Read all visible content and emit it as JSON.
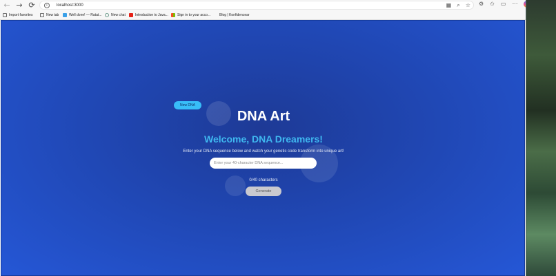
{
  "browser": {
    "url": "localhost:3000",
    "bookmarks": [
      {
        "label": "Import favorites"
      },
      {
        "label": "New tab"
      },
      {
        "label": "Well done! — Ratat..."
      },
      {
        "label": "New chat"
      },
      {
        "label": "Introduction to Java..."
      },
      {
        "label": "Sign in to your acco..."
      },
      {
        "label": "Blog | Konfidencear"
      }
    ]
  },
  "app": {
    "new_dna_label": "New DNA",
    "title": "DNA Art",
    "welcome": "Welcome, DNA Dreamers!",
    "description": "Enter your DNA sequence below and watch your genetic code transform into unique art!",
    "input_placeholder": "Enter your 40-character DNA sequence...",
    "input_value": "",
    "counter": "0/40 characters",
    "generate_label": "Generate"
  },
  "colors": {
    "page_background": "#2557d6",
    "accent_cyan": "#38bdf8",
    "welcome_text": "#3fb8f0",
    "button_disabled": "#c9c9cf"
  }
}
